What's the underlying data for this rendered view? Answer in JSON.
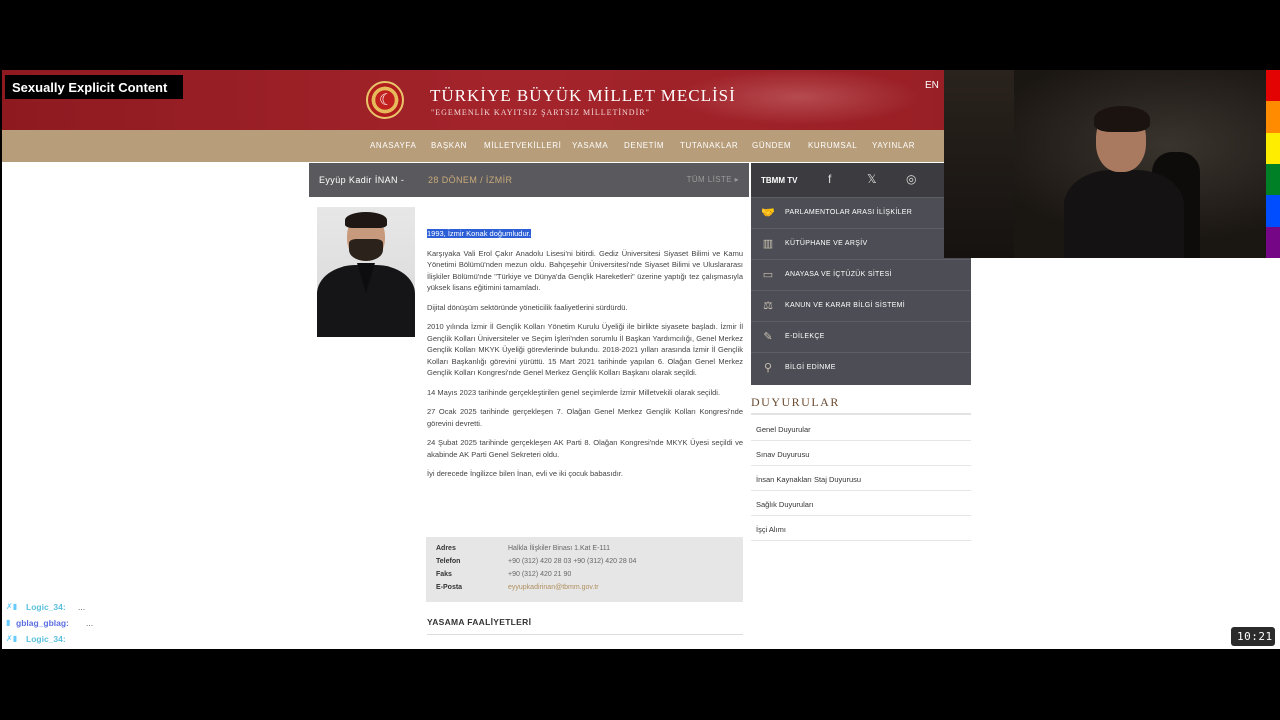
{
  "overlay": {
    "content_warning": "Sexually Explicit Content",
    "clock": "10:21"
  },
  "header": {
    "title": "TÜRKİYE BÜYÜK MİLLET MECLİSİ",
    "motto": "\"EGEMENLİK KAYITSIZ ŞARTSIZ MİLLETİNDİR\"",
    "lang": "EN"
  },
  "nav": [
    "ANASAYFA",
    "BAŞKAN",
    "MİLLETVEKİLLERİ",
    "YASAMA",
    "DENETİM",
    "TUTANAKLAR",
    "GÜNDEM",
    "KURUMSAL",
    "YAYINLAR"
  ],
  "profile": {
    "name": "Eyyüp Kadir İNAN -",
    "term": "28 DÖNEM / İZMİR",
    "all_list": "TÜM LİSTE ▸",
    "bio_highlight": "1993, İzmir Konak doğumludur.",
    "bio": [
      "Karşıyaka Vali Erol Çakır Anadolu Lisesi'ni bitirdi. Gediz Üniversitesi Siyaset Bilimi ve Kamu Yönetimi Bölümü'nden mezun oldu. Bahçeşehir Üniversitesi'nde Siyaset Bilimi ve Uluslararası İlişkiler Bölümü'nde \"Türkiye ve Dünya'da Gençlik Hareketleri\" üzerine yaptığı tez çalışmasıyla yüksek lisans eğitimini tamamladı.",
      "Dijital dönüşüm sektöründe yöneticilik faaliyetlerini sürdürdü.",
      "2010 yılında İzmir İl Gençlik Kolları Yönetim Kurulu Üyeliği ile birlikte siyasete başladı. İzmir İl Gençlik Kolları Üniversiteler ve Seçim İşleri'nden sorumlu İl Başkan Yardımcılığı, Genel Merkez Gençlik Kolları MKYK Üyeliği görevlerinde bulundu. 2018-2021 yılları arasında İzmir İl Gençlik Kolları Başkanlığı görevini yürüttü. 15 Mart 2021 tarihinde yapılan 6. Olağan Genel Merkez Gençlik Kolları Kongresi'nde Genel Merkez Gençlik Kolları Başkanı olarak seçildi.",
      "14 Mayıs 2023 tarihinde gerçekleştirilen genel seçimlerde İzmir Milletvekili olarak seçildi.",
      "27 Ocak 2025 tarihinde gerçekleşen 7. Olağan Genel Merkez Gençlik Kolları Kongresi'nde görevini devretti.",
      "24 Şubat 2025 tarihinde gerçekleşen AK Parti 8. Olağan Kongresi'nde MKYK Üyesi seçildi ve akabinde AK Parti Genel Sekreteri oldu.",
      "İyi derecede İngilizce bilen İnan, evli ve iki çocuk babasıdır."
    ],
    "contact": [
      {
        "label": "Adres",
        "value": "Halkla İlişkiler Binası 1.Kat E-111"
      },
      {
        "label": "Telefon",
        "value": "+90 (312) 420 28 03 +90 (312) 420 28 04"
      },
      {
        "label": "Faks",
        "value": "+90 (312) 420 21 90"
      },
      {
        "label": "E-Posta",
        "value": "eyyupkadirinan@tbmm.gov.tr"
      }
    ],
    "yasama_title": "YASAMA FAALİYETLERİ"
  },
  "sidebar": {
    "tv_label": "TBMM TV",
    "social": [
      "f",
      "𝕏",
      "◎"
    ],
    "menu": [
      {
        "label": "PARLAMENTOLAR ARASI İLİŞKİLER",
        "icon": "handshake-icon"
      },
      {
        "label": "KÜTÜPHANE VE ARŞİV",
        "icon": "book-icon"
      },
      {
        "label": "ANAYASA VE İÇTÜZÜK SİTESİ",
        "icon": "document-icon"
      },
      {
        "label": "KANUN VE KARAR BİLGİ SİSTEMİ",
        "icon": "scales-icon"
      },
      {
        "label": "E-DİLEKÇE",
        "icon": "pen-icon"
      },
      {
        "label": "BİLGİ EDİNME",
        "icon": "search-icon"
      }
    ],
    "announcements_title": "DUYURULAR",
    "announcements": [
      "Genel Duyurular",
      "Sınav Duyurusu",
      "İnsan Kaynakları Staj Duyurusu",
      "Sağlık Duyuruları",
      "İşçi Alımı"
    ]
  },
  "chat": [
    {
      "user": "Logic_34:",
      "color": "#5bc0de",
      "msg": "..."
    },
    {
      "user": "gblag_gblag:",
      "color": "#5b6ee1",
      "msg": "..."
    },
    {
      "user": "Logic_34:",
      "color": "#5bc0de",
      "msg": ""
    }
  ],
  "colors": {
    "header_red": "#a4242b",
    "nav_gold": "#b79d7a",
    "sidebar_gray": "#4d4e55",
    "highlight_blue": "#2c5fd6"
  }
}
